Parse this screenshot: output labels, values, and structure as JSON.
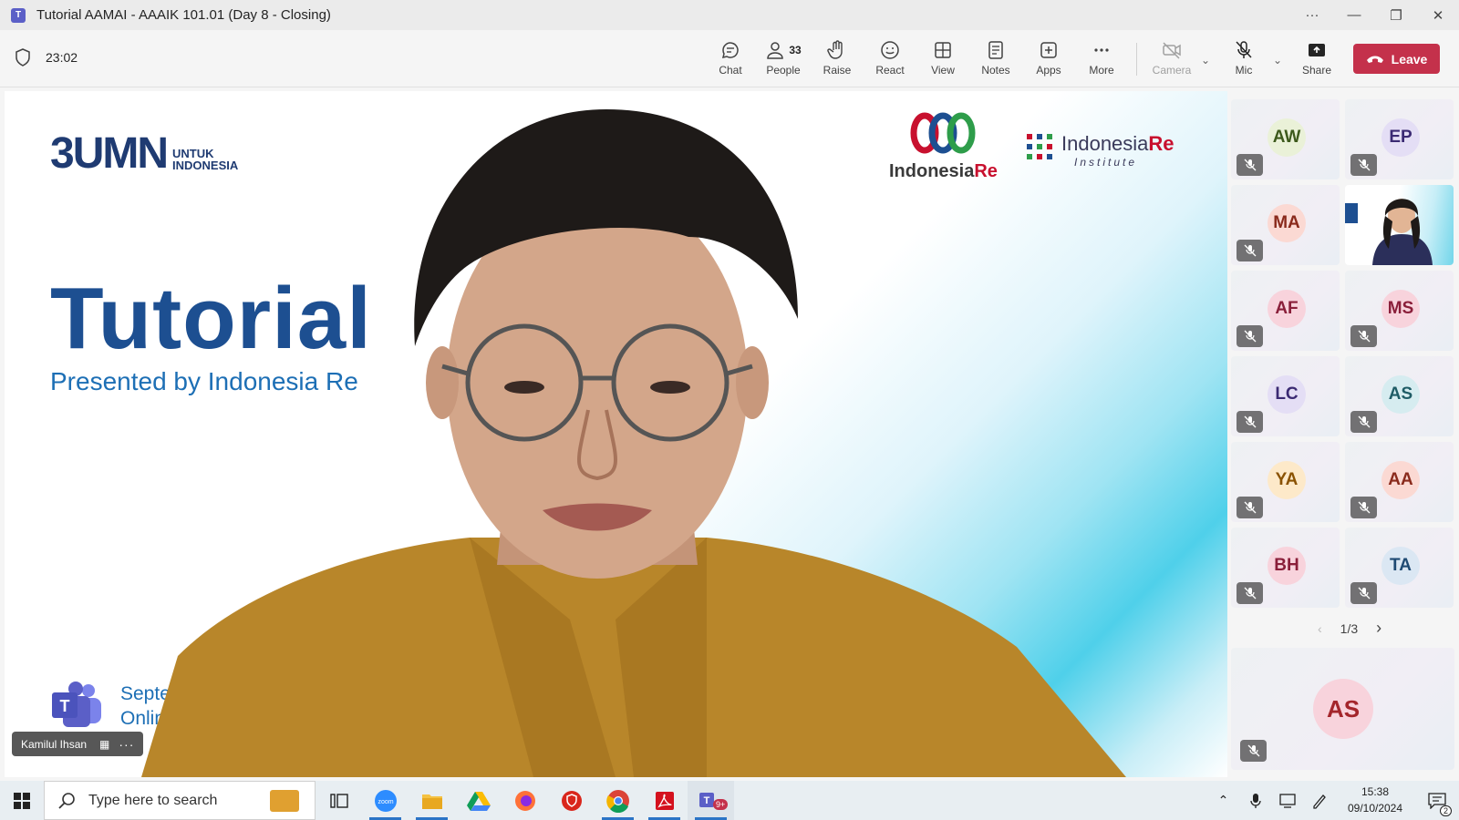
{
  "window": {
    "title": "Tutorial AAMAI - AAAIK 101.01 (Day 8 - Closing)"
  },
  "toolbar": {
    "timer": "23:02",
    "chat": "Chat",
    "people": "People",
    "people_count": "33",
    "raise": "Raise",
    "react": "React",
    "view": "View",
    "notes": "Notes",
    "apps": "Apps",
    "more": "More",
    "camera": "Camera",
    "mic": "Mic",
    "share": "Share",
    "leave": "Leave"
  },
  "slide": {
    "bumn_mark": "3UMN",
    "bumn_sub_1": "UNTUK",
    "bumn_sub_2": "INDONESIA",
    "title": "Tutorial",
    "subtitle": "Presented by Indonesia Re",
    "date_1": "September",
    "date_2": "Online vi",
    "logo_ire_1": "Indonesia",
    "logo_ire_2": "Re",
    "logo_inst_1": "Indonesia",
    "logo_inst_2": "Re",
    "logo_inst_3": "Institute"
  },
  "presenter": {
    "name": "Kamilul Ihsan"
  },
  "participants": [
    {
      "initials": "AW",
      "bg": "#eaf1d8",
      "fg": "#3d5a1c"
    },
    {
      "initials": "EP",
      "bg": "#e4def5",
      "fg": "#3b2a73"
    },
    {
      "initials": "MA",
      "bg": "#fbd9d3",
      "fg": "#8a2a1c"
    },
    {
      "initials": "",
      "video": true
    },
    {
      "initials": "AF",
      "bg": "#f8d3dc",
      "fg": "#8a1f3a"
    },
    {
      "initials": "MS",
      "bg": "#f8d3dc",
      "fg": "#8a1f3a"
    },
    {
      "initials": "LC",
      "bg": "#e4def5",
      "fg": "#3b2a73"
    },
    {
      "initials": "AS",
      "bg": "#d6ecf0",
      "fg": "#1f5c66"
    },
    {
      "initials": "YA",
      "bg": "#fde9c9",
      "fg": "#8a5200"
    },
    {
      "initials": "AA",
      "bg": "#fbd9d3",
      "fg": "#8a2a1c"
    },
    {
      "initials": "BH",
      "bg": "#f8d3dc",
      "fg": "#8a1f3a"
    },
    {
      "initials": "TA",
      "bg": "#dbe7f3",
      "fg": "#1f4a73"
    }
  ],
  "pager": {
    "label": "1/3"
  },
  "spotlight": {
    "initials": "AS"
  },
  "taskbar": {
    "search_placeholder": "Type here to search",
    "time": "15:38",
    "date": "09/10/2024",
    "notif_count": "2",
    "teams_badge": "9+"
  }
}
